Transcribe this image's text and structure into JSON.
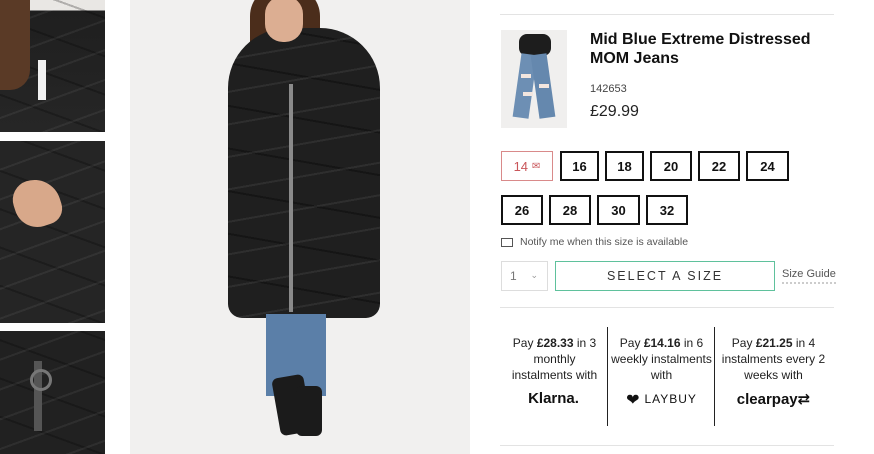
{
  "product": {
    "name": "Mid Blue Extreme Distressed MOM Jeans",
    "sku": "142653",
    "price": "£29.99"
  },
  "sizes": [
    {
      "label": "14",
      "available": false
    },
    {
      "label": "16",
      "available": true
    },
    {
      "label": "18",
      "available": true
    },
    {
      "label": "20",
      "available": true
    },
    {
      "label": "22",
      "available": true
    },
    {
      "label": "24",
      "available": true
    },
    {
      "label": "26",
      "available": true
    },
    {
      "label": "28",
      "available": true
    },
    {
      "label": "30",
      "available": true
    },
    {
      "label": "32",
      "available": true
    }
  ],
  "notify_text": "Notify me when this size is available",
  "quantity": {
    "value": "1"
  },
  "select_size_label": "SELECT A SIZE",
  "size_guide_label": "Size Guide",
  "payments": [
    {
      "pre": "Pay ",
      "amount": "£28.33",
      "post": " in 3 monthly instalments with",
      "logo": "Klarna."
    },
    {
      "pre": "Pay ",
      "amount": "£14.16",
      "post": " in 6 weekly instalments with",
      "logo": "LAYBUY"
    },
    {
      "pre": "Pay ",
      "amount": "£21.25",
      "post": " in 4 instalments every 2 weeks with",
      "logo": "clearpay"
    }
  ],
  "colors": {
    "accent": "#5fc19c",
    "oos": "#c9565a",
    "text": "#111111"
  },
  "icons": [
    "envelope-icon",
    "chevron-down-icon",
    "laybuy-heart-icon",
    "clearpay-arrows-icon"
  ]
}
